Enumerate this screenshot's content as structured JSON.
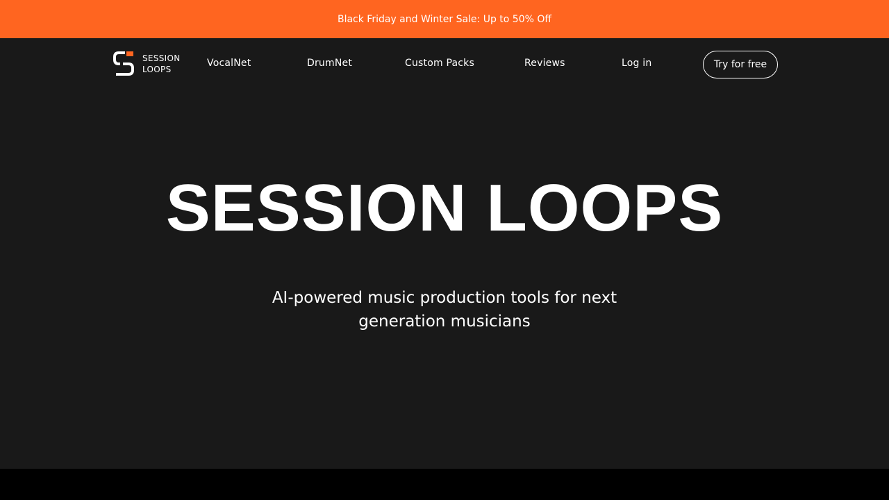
{
  "promo": {
    "text": "Black Friday and Winter Sale: Up to 50% Off"
  },
  "brand": {
    "line1": "SESSION",
    "line2": "LOOPS",
    "logo_icon": "session-loops-s-icon"
  },
  "nav": {
    "items": [
      {
        "label": "VocalNet"
      },
      {
        "label": "DrumNet"
      },
      {
        "label": "Custom Packs"
      },
      {
        "label": "Reviews"
      },
      {
        "label": "Log in"
      }
    ],
    "cta_label": "Try for free"
  },
  "hero": {
    "title": "SESSION LOOPS",
    "subtitle": "AI-powered music production tools for next generation musicians"
  },
  "colors": {
    "accent": "#ff6520",
    "background": "#191919",
    "text": "#ffffff"
  }
}
